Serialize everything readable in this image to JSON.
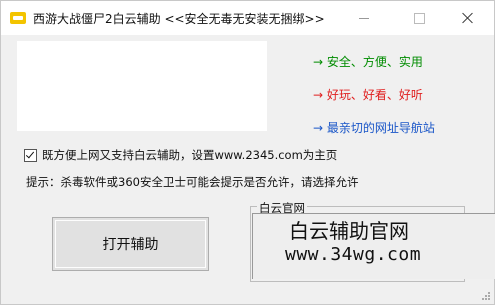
{
  "window": {
    "title": "西游大战僵尸2白云辅助 <<安全无毒无安装无捆绑>>"
  },
  "links": [
    {
      "label": "→ 安全、方便、实用",
      "color": "#008c00"
    },
    {
      "label": "→ 好玩、好看、好听",
      "color": "#e02020"
    },
    {
      "label": "→ 最亲切的网址导航站",
      "color": "#1a56c8"
    }
  ],
  "options": {
    "homepage_checkbox_label": "既方便上网又支持白云辅助，设置www.2345.com为主页",
    "homepage_checked": true
  },
  "tip": "提示：杀毒软件或360安全卫士可能会提示是否允许，请选择允许",
  "main_button": "打开辅助",
  "official_site": {
    "group_label": "白云官网",
    "title": "白云辅助官网",
    "url": "www.34wg.com"
  }
}
